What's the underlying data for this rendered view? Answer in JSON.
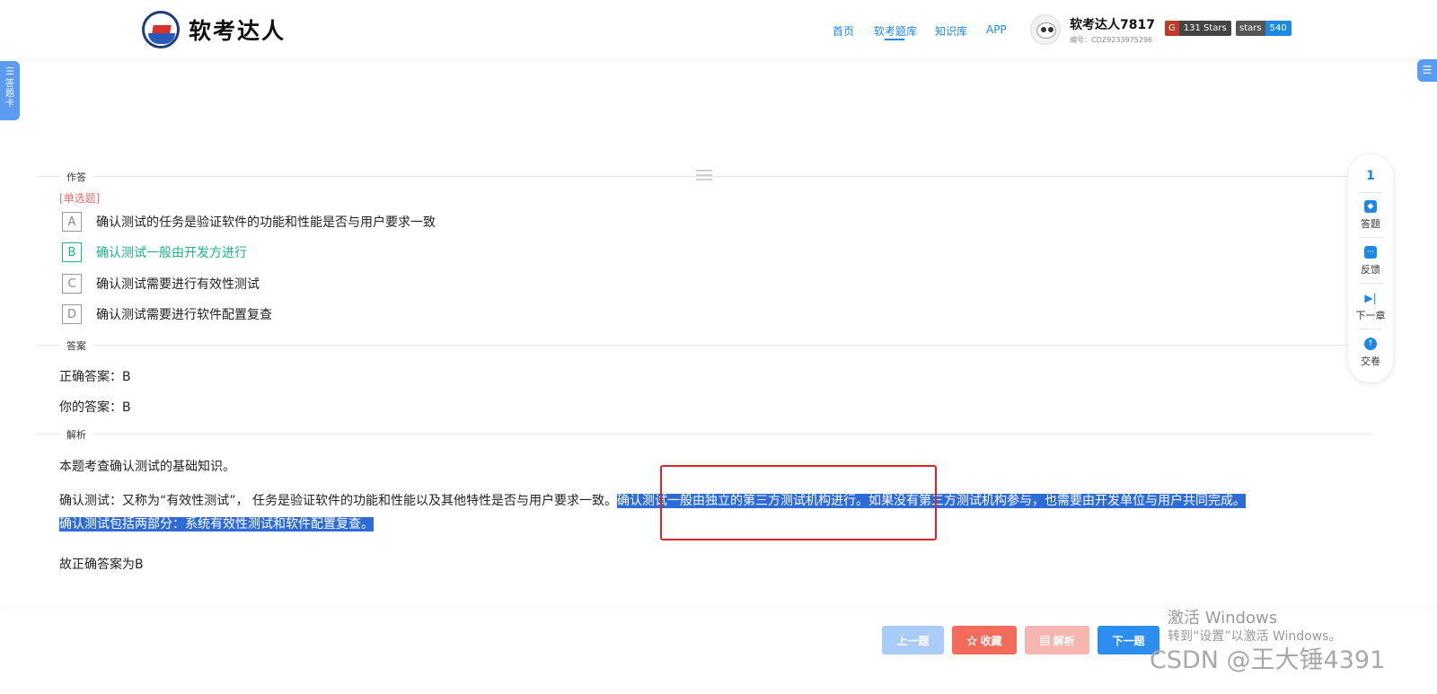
{
  "header": {
    "logo_text": "软考达人",
    "nav": [
      {
        "label": "首页"
      },
      {
        "label": "软考题库"
      },
      {
        "label": "知识库"
      },
      {
        "label": "APP"
      }
    ],
    "user": {
      "name": "软考达人7817",
      "id_text": "编号：CDZ9233975296"
    },
    "badges": [
      {
        "left": "G",
        "right": "131 Stars"
      },
      {
        "left": "stars",
        "right": "540"
      }
    ]
  },
  "left_tab": {
    "label": "答题卡"
  },
  "sections": {
    "answering": "作答",
    "answer": "答案",
    "analysis": "解析"
  },
  "question": {
    "type_label": "[单选题]",
    "options": [
      {
        "letter": "A",
        "text": "确认测试的任务是验证软件的功能和性能是否与用户要求一致"
      },
      {
        "letter": "B",
        "text": "确认测试一般由开发方进行"
      },
      {
        "letter": "C",
        "text": "确认测试需要进行有效性测试"
      },
      {
        "letter": "D",
        "text": "确认测试需要进行软件配置复查"
      }
    ]
  },
  "answer": {
    "correct_label": "正确答案：",
    "correct_value": "B",
    "yours_label": "你的答案：",
    "yours_value": "B"
  },
  "analysis": {
    "intro": "本题考查确认测试的基础知识。",
    "line1_plain": "确认测试：又称为“有效性测试”， 任务是验证软件的功能和性能以及其他特性是否与用户要求一致。",
    "line1_highlight": "确认测试一般由独立的第三方测试机构进行。如果没有第三方测试机构参与，也需要由开发单位与用户共同完成。",
    "line2_highlight": "确认测试包括两部分：系统有效性测试和软件配置复查。",
    "conclusion": "故正确答案为B"
  },
  "side_panel": {
    "current_number": "1",
    "items": [
      {
        "label": "答题",
        "icon": "answer-icon"
      },
      {
        "label": "反馈",
        "icon": "feedback-icon"
      },
      {
        "label": "下一章",
        "icon": "next-chapter-icon"
      },
      {
        "label": "交卷",
        "icon": "submit-icon"
      }
    ]
  },
  "buttons": {
    "prev": "上一题",
    "favorite": "☆ 收藏",
    "analysis": "▤ 解析",
    "next": "下一题"
  },
  "watermarks": {
    "activate_title": "激活 Windows",
    "activate_sub": "转到“设置”以激活 Windows。",
    "csdn": "CSDN @王大锤4391"
  },
  "colors": {
    "accent": "#1e88e5",
    "correct": "#1bb68a",
    "type_label": "#e86c6c",
    "highlight": "#2e6bd6",
    "annotation_box": "#e02424"
  }
}
